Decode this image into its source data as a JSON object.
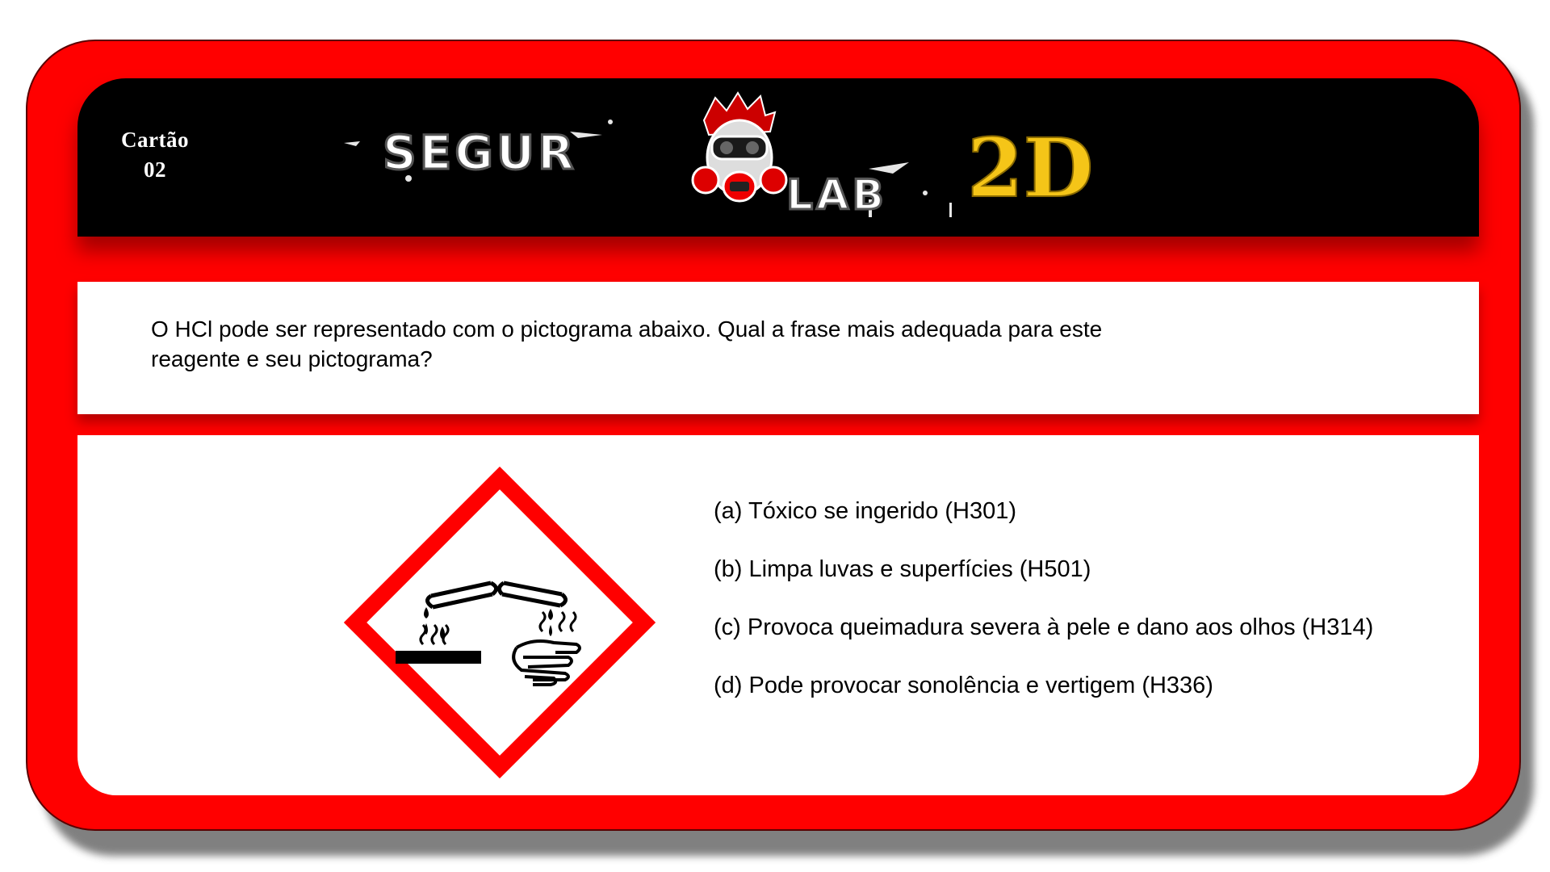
{
  "card": {
    "label_line1": "Cartão",
    "label_line2": "02"
  },
  "logo": {
    "part1": "SEGUR",
    "part2": "LAB",
    "part3": "2D",
    "accent_color": "#f5c518",
    "mascot": "gas-mask-mascot-icon"
  },
  "question": {
    "line1": "O HCl pode ser representado com o pictograma abaixo. Qual a frase mais adequada para este",
    "line2": "reagente e seu pictograma?"
  },
  "pictogram": {
    "icon": "corrosive-ghs-pictogram-icon",
    "border_color": "#ff0000"
  },
  "options": [
    {
      "text": "(a) Tóxico se ingerido (H301)"
    },
    {
      "text": "(b) Limpa luvas e superfícies (H501)"
    },
    {
      "text": "(c) Provoca queimadura severa à pele e dano aos olhos (H314)"
    },
    {
      "text": "(d) Pode provocar sonolência e vertigem (H336)"
    }
  ],
  "colors": {
    "card_red": "#ff0000",
    "header_black": "#000000",
    "panel_white": "#ffffff"
  }
}
